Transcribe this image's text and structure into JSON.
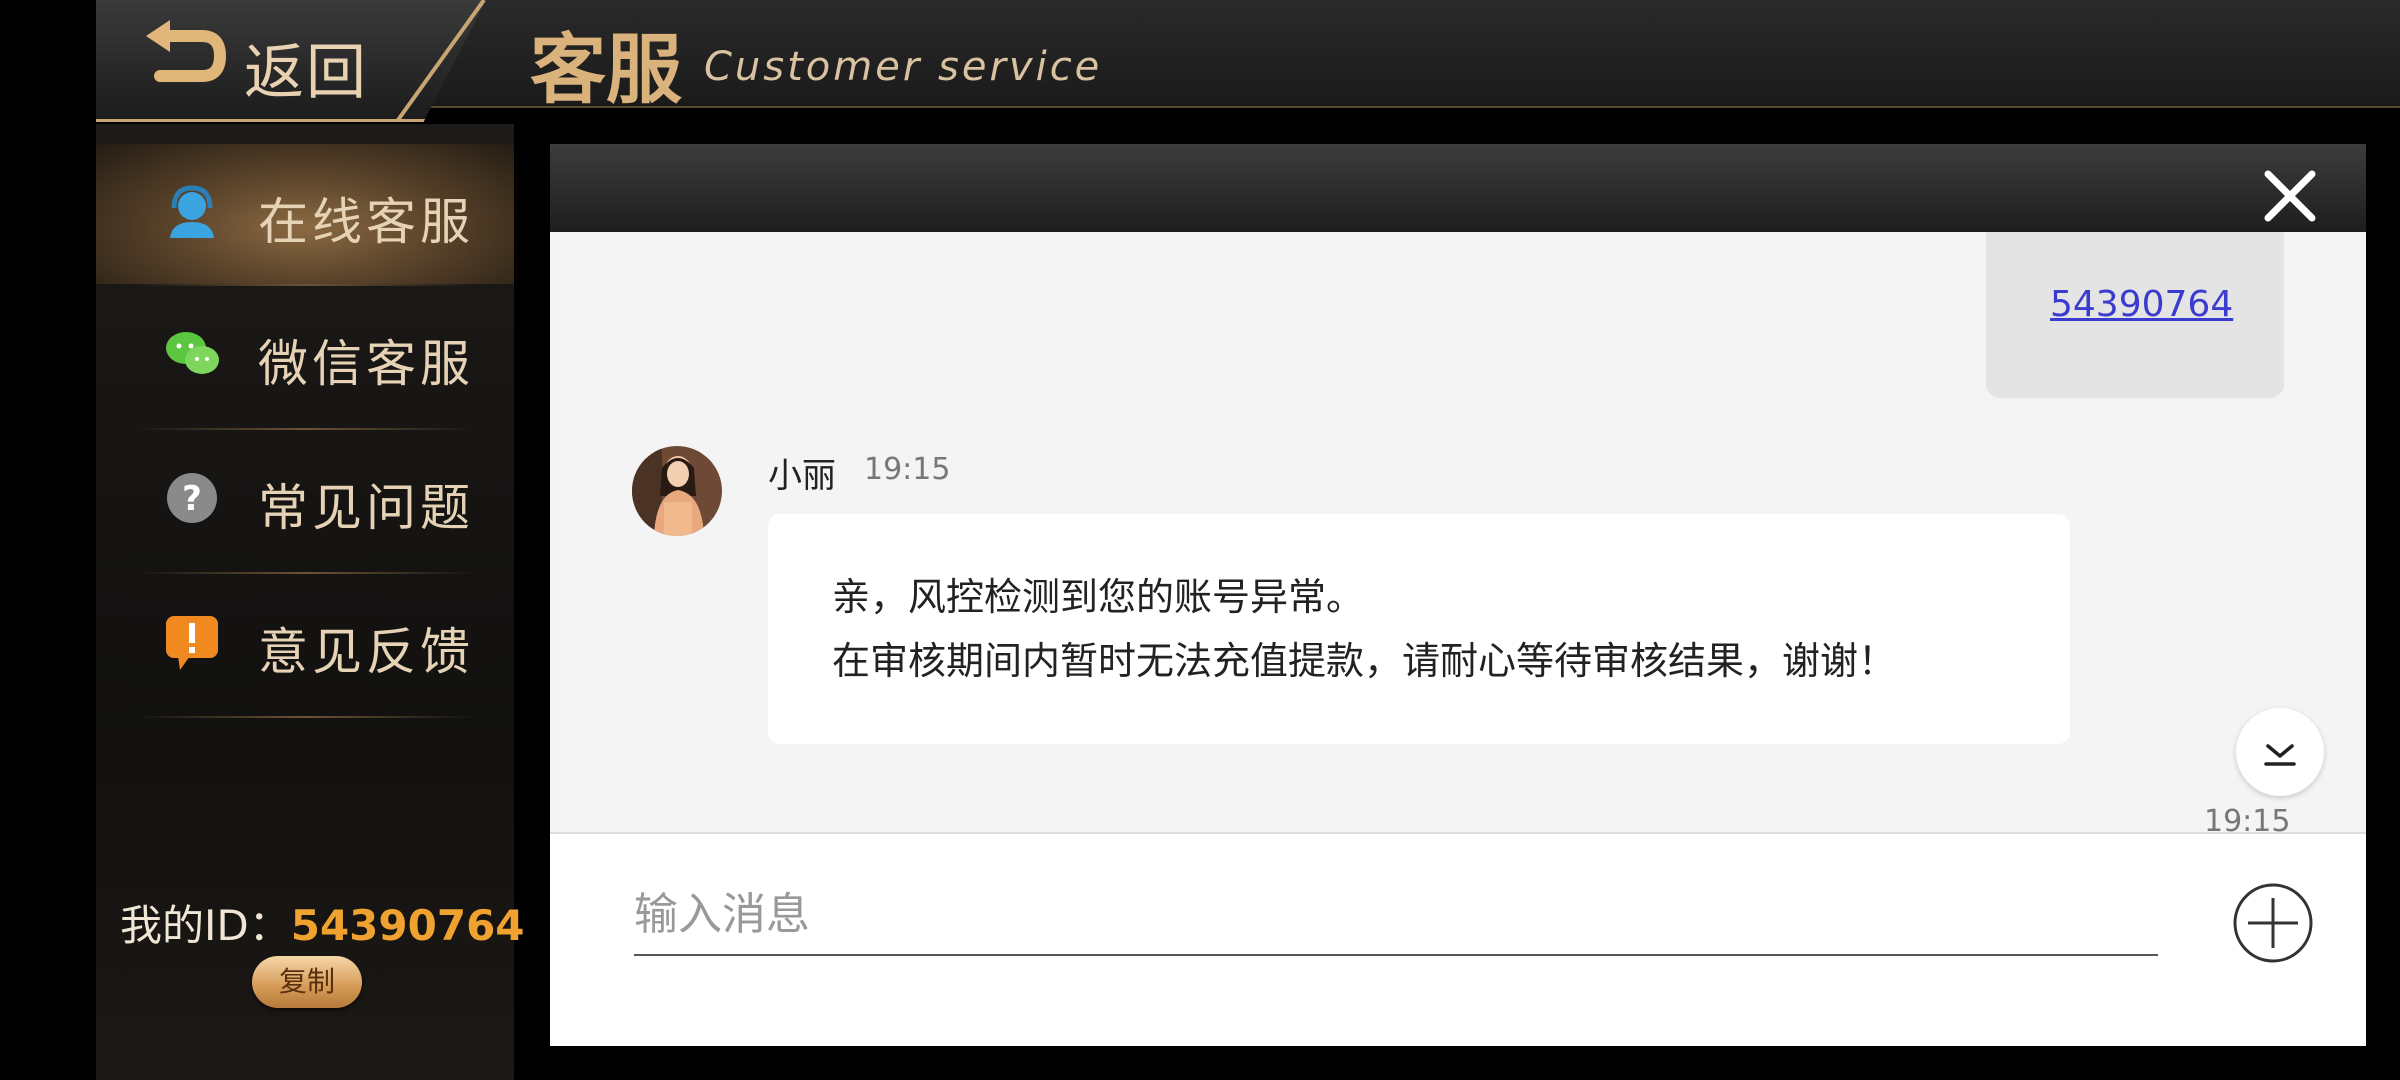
{
  "header": {
    "back_label": "返回",
    "title": "客服",
    "subtitle": "Customer service"
  },
  "sidebar": {
    "items": [
      {
        "label": "在线客服",
        "icon": "headset-icon",
        "active": true
      },
      {
        "label": "微信客服",
        "icon": "wechat-icon",
        "active": false
      },
      {
        "label": "常见问题",
        "icon": "question-icon",
        "active": false
      },
      {
        "label": "意见反馈",
        "icon": "feedback-icon",
        "active": false
      }
    ],
    "id_label": "我的ID：",
    "id_value": "54390764",
    "copy_label": "复制"
  },
  "chat": {
    "my_message": "54390764",
    "agent": {
      "name": "小丽",
      "time": "19:15",
      "lines": [
        "亲，风控检测到您的账号异常。",
        "在审核期间内暂时无法充值提款，请耐心等待审核结果，谢谢！"
      ]
    },
    "bottom_time": "19:15",
    "input_placeholder": "输入消息"
  },
  "colors": {
    "accent_gold": "#d9b27c",
    "id_orange": "#f0a230",
    "link_blue": "#3b3bd0"
  }
}
